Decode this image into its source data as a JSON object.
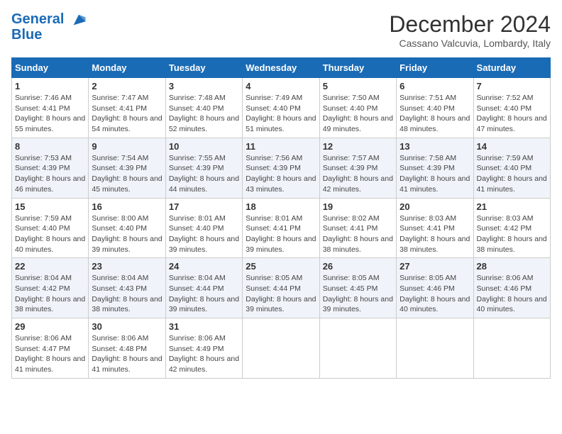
{
  "logo": {
    "line1": "General",
    "line2": "Blue"
  },
  "title": "December 2024",
  "subtitle": "Cassano Valcuvia, Lombardy, Italy",
  "days_of_week": [
    "Sunday",
    "Monday",
    "Tuesday",
    "Wednesday",
    "Thursday",
    "Friday",
    "Saturday"
  ],
  "weeks": [
    [
      {
        "day": "1",
        "sunrise": "Sunrise: 7:46 AM",
        "sunset": "Sunset: 4:41 PM",
        "daylight": "Daylight: 8 hours and 55 minutes."
      },
      {
        "day": "2",
        "sunrise": "Sunrise: 7:47 AM",
        "sunset": "Sunset: 4:41 PM",
        "daylight": "Daylight: 8 hours and 54 minutes."
      },
      {
        "day": "3",
        "sunrise": "Sunrise: 7:48 AM",
        "sunset": "Sunset: 4:40 PM",
        "daylight": "Daylight: 8 hours and 52 minutes."
      },
      {
        "day": "4",
        "sunrise": "Sunrise: 7:49 AM",
        "sunset": "Sunset: 4:40 PM",
        "daylight": "Daylight: 8 hours and 51 minutes."
      },
      {
        "day": "5",
        "sunrise": "Sunrise: 7:50 AM",
        "sunset": "Sunset: 4:40 PM",
        "daylight": "Daylight: 8 hours and 49 minutes."
      },
      {
        "day": "6",
        "sunrise": "Sunrise: 7:51 AM",
        "sunset": "Sunset: 4:40 PM",
        "daylight": "Daylight: 8 hours and 48 minutes."
      },
      {
        "day": "7",
        "sunrise": "Sunrise: 7:52 AM",
        "sunset": "Sunset: 4:40 PM",
        "daylight": "Daylight: 8 hours and 47 minutes."
      }
    ],
    [
      {
        "day": "8",
        "sunrise": "Sunrise: 7:53 AM",
        "sunset": "Sunset: 4:39 PM",
        "daylight": "Daylight: 8 hours and 46 minutes."
      },
      {
        "day": "9",
        "sunrise": "Sunrise: 7:54 AM",
        "sunset": "Sunset: 4:39 PM",
        "daylight": "Daylight: 8 hours and 45 minutes."
      },
      {
        "day": "10",
        "sunrise": "Sunrise: 7:55 AM",
        "sunset": "Sunset: 4:39 PM",
        "daylight": "Daylight: 8 hours and 44 minutes."
      },
      {
        "day": "11",
        "sunrise": "Sunrise: 7:56 AM",
        "sunset": "Sunset: 4:39 PM",
        "daylight": "Daylight: 8 hours and 43 minutes."
      },
      {
        "day": "12",
        "sunrise": "Sunrise: 7:57 AM",
        "sunset": "Sunset: 4:39 PM",
        "daylight": "Daylight: 8 hours and 42 minutes."
      },
      {
        "day": "13",
        "sunrise": "Sunrise: 7:58 AM",
        "sunset": "Sunset: 4:39 PM",
        "daylight": "Daylight: 8 hours and 41 minutes."
      },
      {
        "day": "14",
        "sunrise": "Sunrise: 7:59 AM",
        "sunset": "Sunset: 4:40 PM",
        "daylight": "Daylight: 8 hours and 41 minutes."
      }
    ],
    [
      {
        "day": "15",
        "sunrise": "Sunrise: 7:59 AM",
        "sunset": "Sunset: 4:40 PM",
        "daylight": "Daylight: 8 hours and 40 minutes."
      },
      {
        "day": "16",
        "sunrise": "Sunrise: 8:00 AM",
        "sunset": "Sunset: 4:40 PM",
        "daylight": "Daylight: 8 hours and 39 minutes."
      },
      {
        "day": "17",
        "sunrise": "Sunrise: 8:01 AM",
        "sunset": "Sunset: 4:40 PM",
        "daylight": "Daylight: 8 hours and 39 minutes."
      },
      {
        "day": "18",
        "sunrise": "Sunrise: 8:01 AM",
        "sunset": "Sunset: 4:41 PM",
        "daylight": "Daylight: 8 hours and 39 minutes."
      },
      {
        "day": "19",
        "sunrise": "Sunrise: 8:02 AM",
        "sunset": "Sunset: 4:41 PM",
        "daylight": "Daylight: 8 hours and 38 minutes."
      },
      {
        "day": "20",
        "sunrise": "Sunrise: 8:03 AM",
        "sunset": "Sunset: 4:41 PM",
        "daylight": "Daylight: 8 hours and 38 minutes."
      },
      {
        "day": "21",
        "sunrise": "Sunrise: 8:03 AM",
        "sunset": "Sunset: 4:42 PM",
        "daylight": "Daylight: 8 hours and 38 minutes."
      }
    ],
    [
      {
        "day": "22",
        "sunrise": "Sunrise: 8:04 AM",
        "sunset": "Sunset: 4:42 PM",
        "daylight": "Daylight: 8 hours and 38 minutes."
      },
      {
        "day": "23",
        "sunrise": "Sunrise: 8:04 AM",
        "sunset": "Sunset: 4:43 PM",
        "daylight": "Daylight: 8 hours and 38 minutes."
      },
      {
        "day": "24",
        "sunrise": "Sunrise: 8:04 AM",
        "sunset": "Sunset: 4:44 PM",
        "daylight": "Daylight: 8 hours and 39 minutes."
      },
      {
        "day": "25",
        "sunrise": "Sunrise: 8:05 AM",
        "sunset": "Sunset: 4:44 PM",
        "daylight": "Daylight: 8 hours and 39 minutes."
      },
      {
        "day": "26",
        "sunrise": "Sunrise: 8:05 AM",
        "sunset": "Sunset: 4:45 PM",
        "daylight": "Daylight: 8 hours and 39 minutes."
      },
      {
        "day": "27",
        "sunrise": "Sunrise: 8:05 AM",
        "sunset": "Sunset: 4:46 PM",
        "daylight": "Daylight: 8 hours and 40 minutes."
      },
      {
        "day": "28",
        "sunrise": "Sunrise: 8:06 AM",
        "sunset": "Sunset: 4:46 PM",
        "daylight": "Daylight: 8 hours and 40 minutes."
      }
    ],
    [
      {
        "day": "29",
        "sunrise": "Sunrise: 8:06 AM",
        "sunset": "Sunset: 4:47 PM",
        "daylight": "Daylight: 8 hours and 41 minutes."
      },
      {
        "day": "30",
        "sunrise": "Sunrise: 8:06 AM",
        "sunset": "Sunset: 4:48 PM",
        "daylight": "Daylight: 8 hours and 41 minutes."
      },
      {
        "day": "31",
        "sunrise": "Sunrise: 8:06 AM",
        "sunset": "Sunset: 4:49 PM",
        "daylight": "Daylight: 8 hours and 42 minutes."
      },
      null,
      null,
      null,
      null
    ]
  ]
}
